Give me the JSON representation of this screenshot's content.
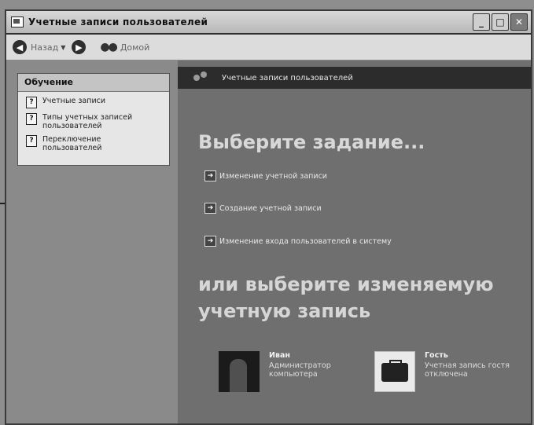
{
  "window": {
    "title": "Учетные записи пользователей"
  },
  "toolbar": {
    "back_label": "Назад",
    "home_label": "Домой"
  },
  "sidebar": {
    "learn_title": "Обучение",
    "items": [
      {
        "label": "Учетные записи"
      },
      {
        "label": "Типы учетных записей пользователей"
      },
      {
        "label": "Переключение пользователей"
      }
    ]
  },
  "main": {
    "header": "Учетные записи пользователей",
    "pick_task": "Выберите задание...",
    "tasks": [
      {
        "label": "Изменение учетной записи"
      },
      {
        "label": "Создание учетной записи"
      },
      {
        "label": "Изменение входа пользователей в систему"
      }
    ],
    "or_pick": "или выберите изменяемую учетную запись",
    "accounts": [
      {
        "name": "Иван",
        "desc": "Администратор компьютера"
      },
      {
        "name": "Гость",
        "desc": "Учетная запись гостя отключена"
      }
    ]
  }
}
